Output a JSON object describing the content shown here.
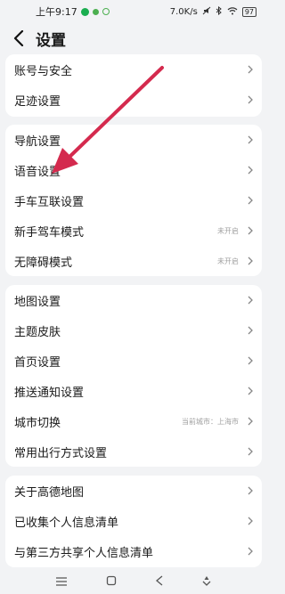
{
  "status_bar": {
    "time": "上午9:17",
    "speed": "7.0K/s",
    "battery": "97"
  },
  "header": {
    "title": "设置"
  },
  "groups": [
    {
      "items": [
        {
          "label": "账号与安全",
          "status": ""
        },
        {
          "label": "足迹设置",
          "status": ""
        }
      ]
    },
    {
      "items": [
        {
          "label": "导航设置",
          "status": ""
        },
        {
          "label": "语音设置",
          "status": ""
        },
        {
          "label": "手车互联设置",
          "status": ""
        },
        {
          "label": "新手驾车模式",
          "status": "未开启"
        },
        {
          "label": "无障碍模式",
          "status": "未开启"
        }
      ]
    },
    {
      "items": [
        {
          "label": "地图设置",
          "status": ""
        },
        {
          "label": "主题皮肤",
          "status": ""
        },
        {
          "label": "首页设置",
          "status": ""
        },
        {
          "label": "推送通知设置",
          "status": ""
        },
        {
          "label": "城市切换",
          "status": "当前城市：上海市"
        },
        {
          "label": "常用出行方式设置",
          "status": ""
        }
      ]
    },
    {
      "items": [
        {
          "label": "关于高德地图",
          "status": ""
        },
        {
          "label": "已收集个人信息清单",
          "status": ""
        },
        {
          "label": "与第三方共享个人信息清单",
          "status": ""
        }
      ]
    }
  ],
  "colors": {
    "arrow": "#d42a4e",
    "background": "#f2f3f5"
  },
  "icons": [
    "back-icon",
    "chevron-right-icon",
    "menu-icon",
    "home-icon",
    "nav-back-icon",
    "assist-icon"
  ]
}
